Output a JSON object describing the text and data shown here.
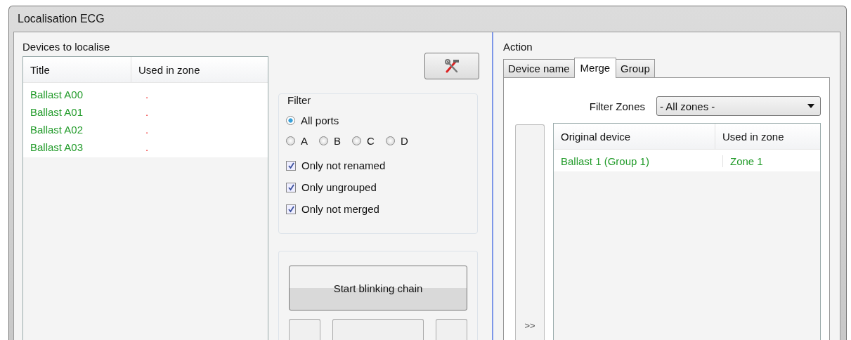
{
  "window": {
    "title": "Localisation ECG"
  },
  "devices": {
    "label": "Devices to localise",
    "columns": [
      "Title",
      "Used in zone"
    ],
    "rows": [
      {
        "title": "Ballast A00",
        "zone": "."
      },
      {
        "title": "Ballast A01",
        "zone": "."
      },
      {
        "title": "Ballast A02",
        "zone": "."
      },
      {
        "title": "Ballast A03",
        "zone": "."
      }
    ]
  },
  "filter": {
    "label": "Filter",
    "ports": [
      {
        "label": "All ports",
        "selected": true
      },
      {
        "label": "A",
        "selected": false
      },
      {
        "label": "B",
        "selected": false
      },
      {
        "label": "C",
        "selected": false
      },
      {
        "label": "D",
        "selected": false
      }
    ],
    "options": [
      {
        "label": "Only not renamed",
        "checked": true
      },
      {
        "label": "Only ungrouped",
        "checked": true
      },
      {
        "label": "Only not merged",
        "checked": true
      }
    ]
  },
  "blink_button": "Start blinking chain",
  "action": {
    "label": "Action",
    "tabs": [
      {
        "label": "Device name",
        "selected": false
      },
      {
        "label": "Merge",
        "selected": true
      },
      {
        "label": "Group",
        "selected": false
      }
    ],
    "filter_zones": {
      "label": "Filter Zones",
      "value": "- All zones -"
    },
    "move_button": ">>",
    "columns": [
      "Original device",
      "Used in zone"
    ],
    "rows": [
      {
        "device": "Ballast 1 (Group 1)",
        "zone": "Zone 1"
      }
    ]
  }
}
